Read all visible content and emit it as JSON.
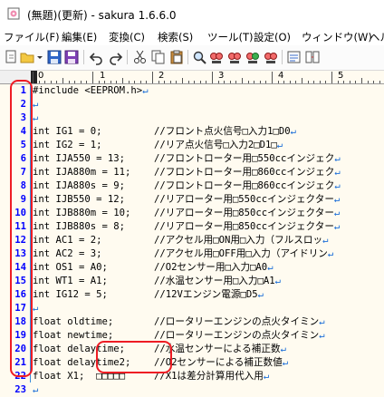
{
  "window": {
    "title": "(無題)(更新) - sakura 1.6.6.0"
  },
  "menu": [
    {
      "label": "ファイル(F)"
    },
    {
      "label": "編集(E)"
    },
    {
      "label": "変換(C)"
    },
    {
      "label": "検索(S)"
    },
    {
      "label": "ツール(T)"
    },
    {
      "label": "設定(O)"
    },
    {
      "label": "ウィンドウ(W)"
    },
    {
      "label": "ヘル"
    }
  ],
  "toolbar_icons": [
    "new-document-icon",
    "open-folder-icon",
    "open-dropdown-icon",
    "save-icon",
    "save-as-icon",
    "undo-icon",
    "redo-icon",
    "cut-icon",
    "copy-icon",
    "paste-icon",
    "search-icon",
    "find-prev-icon",
    "find-next-icon",
    "replace-icon",
    "jump-icon",
    "grep-icon",
    "compare-icon"
  ],
  "ruler": {
    "labels": [
      "0",
      "1",
      "2",
      "3",
      "4",
      "5"
    ]
  },
  "editor": {
    "eol_mark": "↵",
    "lines": [
      {
        "num": "1",
        "code": "#include <EEPROM.h>",
        "comment": ""
      },
      {
        "num": "2",
        "code": "",
        "comment": ""
      },
      {
        "num": "3",
        "code": "",
        "comment": ""
      },
      {
        "num": "4",
        "code": "int IG1 = 0;",
        "comment": "//フロント点火信号□入力1□D0"
      },
      {
        "num": "5",
        "code": "int IG2 = 1;",
        "comment": "//リア点火信号□入力2□D1□"
      },
      {
        "num": "6",
        "code": "int IJA550 = 13;",
        "comment": "//フロントローター用□550ccインジェク"
      },
      {
        "num": "7",
        "code": "int IJA880m = 11;",
        "comment": "//フロントローター用□860ccインジェク"
      },
      {
        "num": "8",
        "code": "int IJA880s = 9;",
        "comment": "//フロントローター用□860ccインジェク"
      },
      {
        "num": "9",
        "code": "int IJB550 = 12;",
        "comment": "//リアローター用□550ccインジェクター"
      },
      {
        "num": "10",
        "code": "int IJB880m = 10;",
        "comment": "//リアローター用□850ccインジェクター"
      },
      {
        "num": "11",
        "code": "int IJB880s = 8;",
        "comment": "//リアローター用□850ccインジェクター"
      },
      {
        "num": "12",
        "code": "int AC1 = 2;",
        "comment": "//アクセル用□ON用□入力（フルスロッ"
      },
      {
        "num": "13",
        "code": "int AC2 = 3;",
        "comment": "//アクセル用□OFF用□入力（アイドリン"
      },
      {
        "num": "14",
        "code": "int OS1 = A0;",
        "comment": "//O2センサー用□入力□A0"
      },
      {
        "num": "15",
        "code": "int WT1 = A1;",
        "comment": "//水温センサー用□入力□A1"
      },
      {
        "num": "16",
        "code": "int IG12 = 5;",
        "comment": "//12Vエンジン電源□D5"
      },
      {
        "num": "17",
        "code": "",
        "comment": ""
      },
      {
        "num": "18",
        "code": "float oldtime;",
        "comment": "//ロータリーエンジンの点火タイミン"
      },
      {
        "num": "19",
        "code": "float newtime;",
        "comment": "//ロータリーエンジンの点火タイミン"
      },
      {
        "num": "20",
        "code": "float delaytime;",
        "comment": "//水温センサーによる補正数"
      },
      {
        "num": "21",
        "code": "float delaytime2;",
        "comment": "//O2センサーによる補正数値"
      },
      {
        "num": "22",
        "code": "float X1;  □□□□□",
        "comment": "//X1は差分計算用代入用"
      },
      {
        "num": "23",
        "code": "",
        "comment": ""
      }
    ]
  },
  "colors": {
    "line_number": "#0000ff",
    "annotation": "#ee1c24",
    "eol_mark": "#1e6fd8",
    "background": "#fffbf0"
  }
}
